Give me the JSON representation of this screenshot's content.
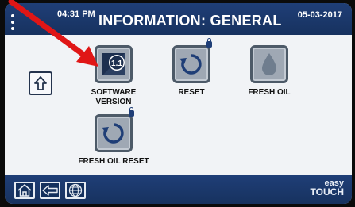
{
  "header": {
    "time": "04:31 PM",
    "title": "INFORMATION: GENERAL",
    "date": "05-03-2017"
  },
  "tiles": [
    {
      "label_line1": "SOFTWARE",
      "label_line2": "VERSION",
      "badge": "1.1",
      "icon": "software-version-icon",
      "locked": false
    },
    {
      "label_line1": "RESET",
      "label_line2": "",
      "icon": "reset-icon",
      "locked": true
    },
    {
      "label_line1": "FRESH OIL",
      "label_line2": "",
      "icon": "oil-drop-icon",
      "locked": false
    },
    {
      "label_line1": "FRESH OIL RESET",
      "label_line2": "",
      "icon": "reset-icon",
      "locked": true
    }
  ],
  "footer": {
    "buttons": [
      "home-icon",
      "back-arrow-icon",
      "globe-icon"
    ],
    "brand_line1": "easy",
    "brand_line2": "TOUCH"
  },
  "colors": {
    "header_bg": "#1f3e77",
    "screen_bg": "#f1f3f6",
    "tile_bg": "#9fa8b4",
    "annotation_arrow": "#e01616"
  }
}
